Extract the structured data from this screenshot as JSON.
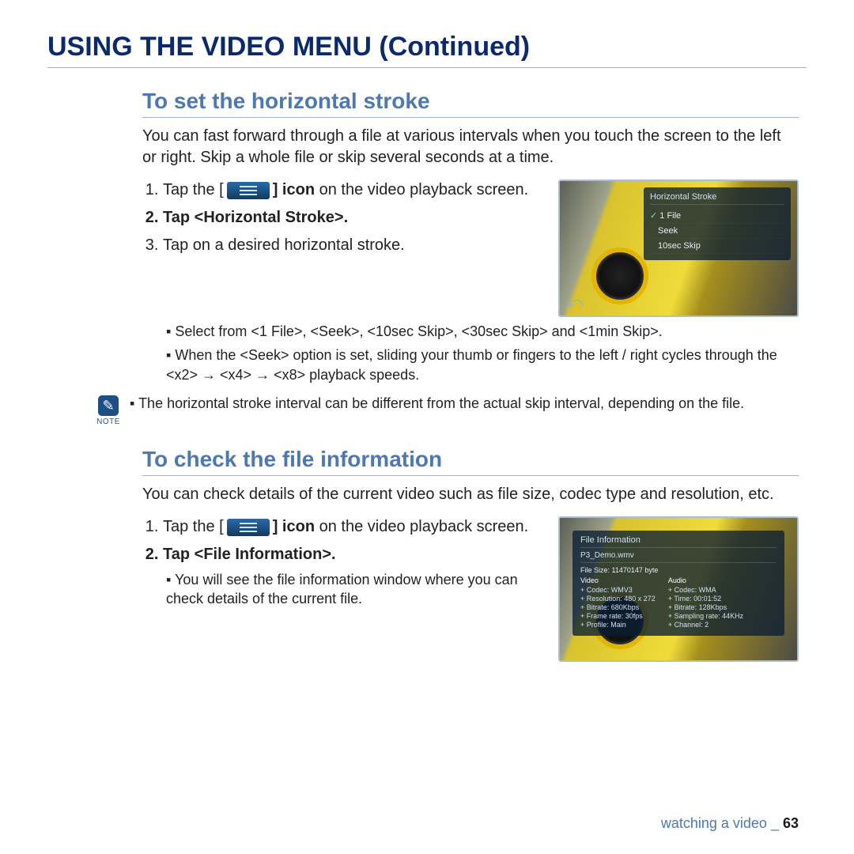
{
  "page_title": "USING THE VIDEO MENU (Continued)",
  "section1": {
    "heading": "To set the horizontal stroke",
    "intro": "You can fast forward through a file at various intervals when you touch the screen to the left or right. Skip a whole file or skip several seconds at a time.",
    "step1_a": "Tap the [",
    "step1_b": "] icon",
    "step1_c": " on the video playback screen.",
    "step2_a": "Tap ",
    "step2_b": "<Horizontal Stroke>",
    "step2_c": ".",
    "step3": "Tap on a desired horizontal stroke.",
    "sub1": "Select from <1 File>, <Seek>, <10sec Skip>, <30sec Skip> and <1min Skip>.",
    "sub2": "When the <Seek> option is set, sliding your thumb or fingers to the left / right cycles through the <x2> → <x4> → <x8> playback speeds.",
    "note": "The horizontal stroke interval can be different from the actual skip interval, depending on the file."
  },
  "section2": {
    "heading": "To check the file information",
    "intro": "You can check details of the current video such as file size, codec type and resolution, etc.",
    "step1_a": "Tap the [",
    "step1_b": "] icon",
    "step1_c": " on the video playback screen.",
    "step2_a": "Tap ",
    "step2_b": "<File Information>",
    "step2_c": ".",
    "sub1": "You will see the file information window where you can check details of the current file."
  },
  "screenshot1": {
    "panel_title": "Horizontal Stroke",
    "opt1": "1 File",
    "opt2": "Seek",
    "opt3": "10sec Skip"
  },
  "screenshot2": {
    "panel_title": "File Information",
    "filename": "P3_Demo.wmv",
    "file_size": "File Size: 11470147 byte",
    "video_head": "Video",
    "v_codec": "+ Codec: WMV3",
    "v_res": "+ Resolution: 480 x 272",
    "v_bitrate": "+ Bitrate: 680Kbps",
    "v_fps": "+ Frame rate: 30fps",
    "v_profile": "+ Profile: Main",
    "audio_head": "Audio",
    "a_codec": "+ Codec: WMA",
    "a_time": "+ Time: 00:01:52",
    "a_bitrate": "+ Bitrate: 128Kbps",
    "a_sample": "+ Sampling rate: 44KHz",
    "a_channel": "+ Channel: 2"
  },
  "note_label": "NOTE",
  "footer": {
    "section": "watching a video _ ",
    "page": "63"
  }
}
